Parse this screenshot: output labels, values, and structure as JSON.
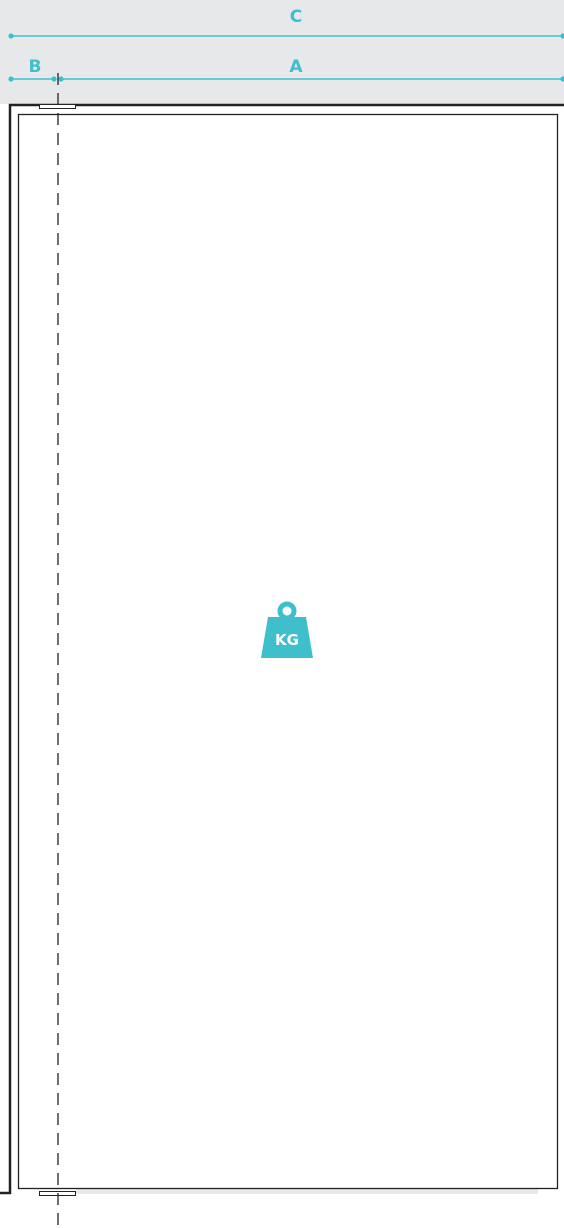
{
  "colors": {
    "accent": "#3fbfcc",
    "band_background": "#e7e8ea",
    "outline": "#222222"
  },
  "dimensions": {
    "c_label": "C",
    "a_label": "A",
    "b_label": "B"
  },
  "weight_icon": {
    "name": "weight-kg-icon",
    "label": "KG"
  }
}
